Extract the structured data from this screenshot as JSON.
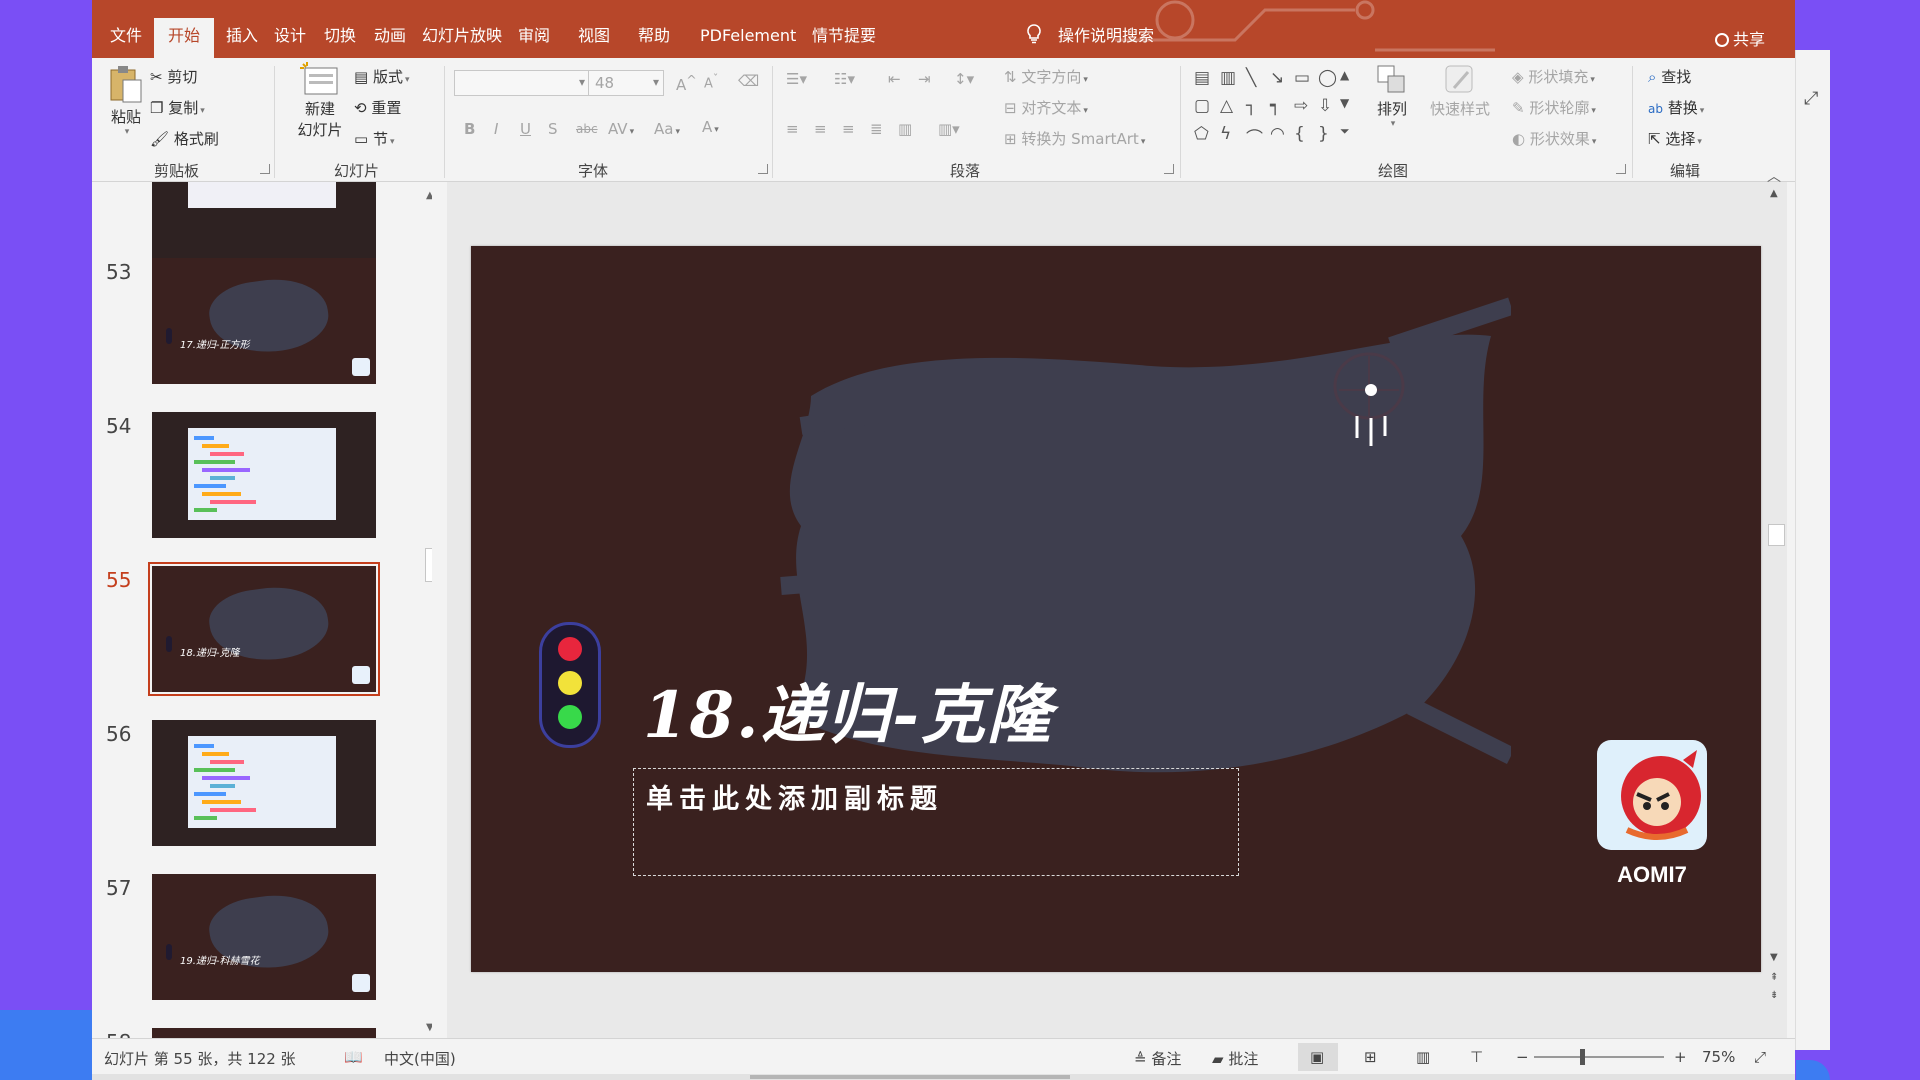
{
  "ribbon_tabs": [
    "文件",
    "开始",
    "插入",
    "设计",
    "切换",
    "动画",
    "幻灯片放映",
    "审阅",
    "视图",
    "帮助",
    "PDFelement",
    "情节提要"
  ],
  "active_tab": "开始",
  "tell_me": "操作说明搜索",
  "share": "共享",
  "clipboard": {
    "paste": "粘贴",
    "cut": "剪切",
    "copy": "复制",
    "format_painter": "格式刷",
    "label": "剪贴板"
  },
  "slides_group": {
    "new_slide_line1": "新建",
    "new_slide_line2": "幻灯片",
    "layout": "版式",
    "reset": "重置",
    "section": "节",
    "label": "幻灯片"
  },
  "font_group": {
    "size": "48",
    "label": "字体",
    "bold": "B",
    "italic": "I",
    "underline": "U",
    "shadow": "S",
    "strike": "abc",
    "spacing": "AV",
    "case": "Aa",
    "color": "A",
    "grow": "A",
    "shrink": "A"
  },
  "paragraph_group": {
    "text_direction": "文字方向",
    "align_text": "对齐文本",
    "smartart": "转换为 SmartArt",
    "label": "段落"
  },
  "drawing_group": {
    "arrange": "排列",
    "quick_styles": "快速样式",
    "shape_fill": "形状填充",
    "shape_outline": "形状轮廓",
    "shape_effects": "形状效果",
    "label": "绘图"
  },
  "editing_group": {
    "find": "查找",
    "replace": "替换",
    "select": "选择",
    "label": "编辑"
  },
  "thumbnails": [
    {
      "num": "53",
      "kind": "title",
      "title": "17.递归-正方形"
    },
    {
      "num": "54",
      "kind": "code",
      "title": ""
    },
    {
      "num": "55",
      "kind": "title",
      "title": "18.递归-克隆",
      "selected": true
    },
    {
      "num": "56",
      "kind": "code",
      "title": ""
    },
    {
      "num": "57",
      "kind": "title",
      "title": "19.递归-科赫雪花"
    },
    {
      "num": "58",
      "kind": "partial",
      "title": ""
    }
  ],
  "slide": {
    "title": "18.递归-克隆",
    "subtitle_placeholder": "单击此处添加副标题",
    "logo_text": "AOMI7",
    "colors": {
      "background": "#3a211f",
      "brush": "#3e3e4e",
      "red": "#e8263d",
      "yellow": "#f2e23a",
      "green": "#38d94a"
    }
  },
  "status": {
    "slide_info": "幻灯片 第 55 张，共 122 张",
    "language": "中文(中国)",
    "notes": "备注",
    "comments": "批注",
    "zoom": "75%"
  },
  "accent_color": "#b7472a"
}
